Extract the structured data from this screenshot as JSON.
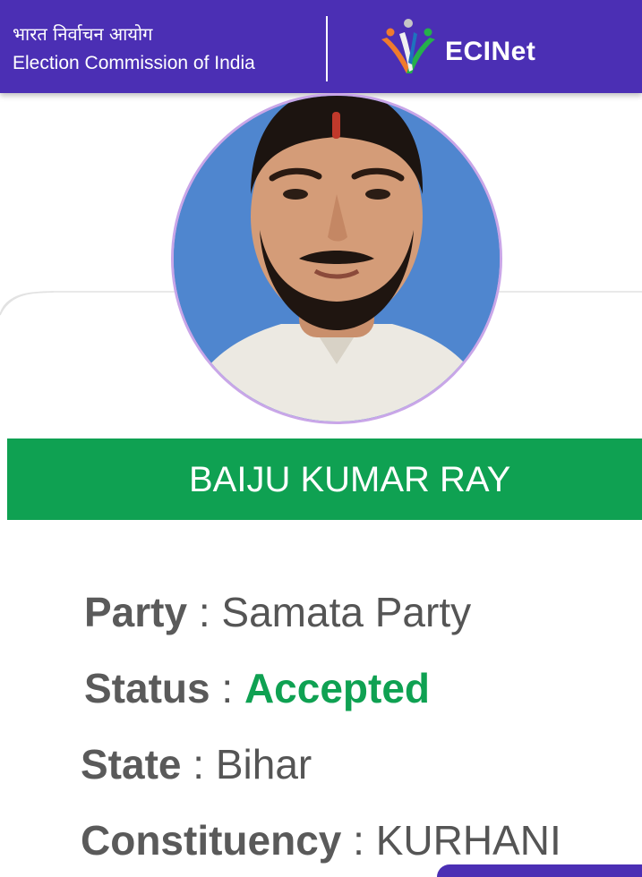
{
  "header": {
    "org_name_hindi": "भारत निर्वाचन आयोग",
    "org_name_english": "Election Commission of India",
    "app_logo_icon": "ecinet-logo-icon",
    "app_name": "ECINet",
    "background_color": "#4b2fb4"
  },
  "candidate": {
    "photo": "candidate-photo",
    "name": "BAIJU KUMAR RAY",
    "name_banner_color": "#0fa152"
  },
  "details": {
    "party_label": "Party",
    "party_value": "Samata Party",
    "status_label": "Status",
    "status_value": "Accepted",
    "status_color": "#0fa152",
    "state_label": "State",
    "state_value": "Bihar",
    "constituency_label": "Constituency",
    "constituency_value": "KURHANI",
    "separator": ":"
  }
}
